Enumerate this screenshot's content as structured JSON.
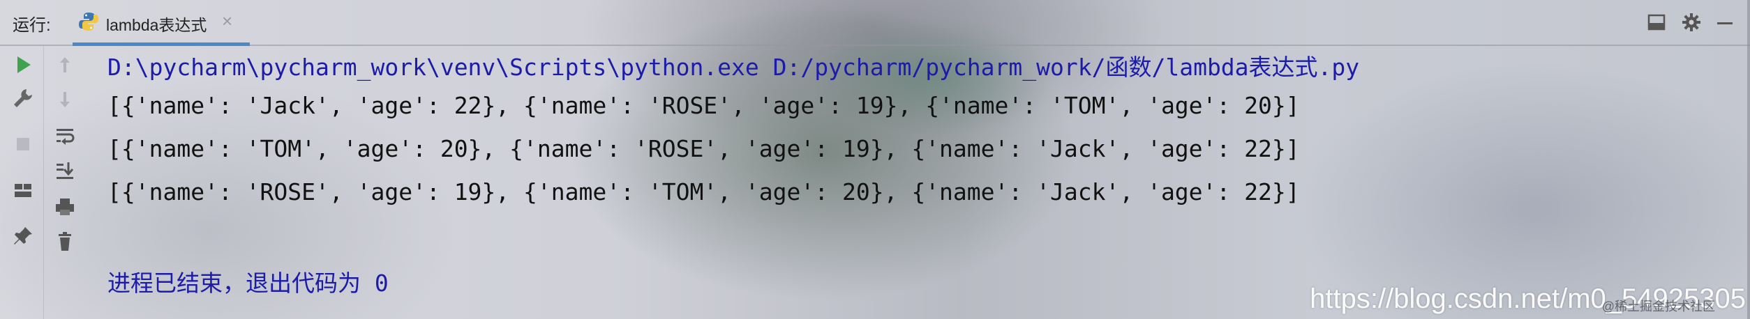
{
  "header": {
    "run_label": "运行:",
    "tab": {
      "title": "lambda表达式",
      "close": "×",
      "icon": "python-icon"
    },
    "actions": [
      "layout-icon",
      "gear-icon",
      "minimize-icon"
    ]
  },
  "left_toolbar": [
    "run-icon",
    "wrench-icon",
    "stop-icon",
    "layout-grid-icon",
    "pin-icon"
  ],
  "second_toolbar": [
    "arrow-up-icon",
    "arrow-down-icon",
    "soft-wrap-icon",
    "scroll-to-end-icon",
    "print-icon",
    "trash-icon"
  ],
  "console": {
    "command": "D:\\pycharm\\pycharm_work\\venv\\Scripts\\python.exe D:/pycharm/pycharm_work/函数/lambda表达式.py",
    "output": [
      "[{'name': 'Jack', 'age': 22}, {'name': 'ROSE', 'age': 19}, {'name': 'TOM', 'age': 20}]",
      "[{'name': 'TOM', 'age': 20}, {'name': 'ROSE', 'age': 19}, {'name': 'Jack', 'age': 22}]",
      "[{'name': 'ROSE', 'age': 19}, {'name': 'TOM', 'age': 20}, {'name': 'Jack', 'age': 22}]"
    ],
    "exit_message": "进程已结束，退出代码为 0"
  },
  "watermark": {
    "url": "https://blog.csdn.net/m0_54925305",
    "sub": "@稀土掘金技术社区"
  },
  "colors": {
    "accent": "#4a88c7",
    "command_text": "#1c1ca8",
    "run_green": "#3fa34d"
  }
}
